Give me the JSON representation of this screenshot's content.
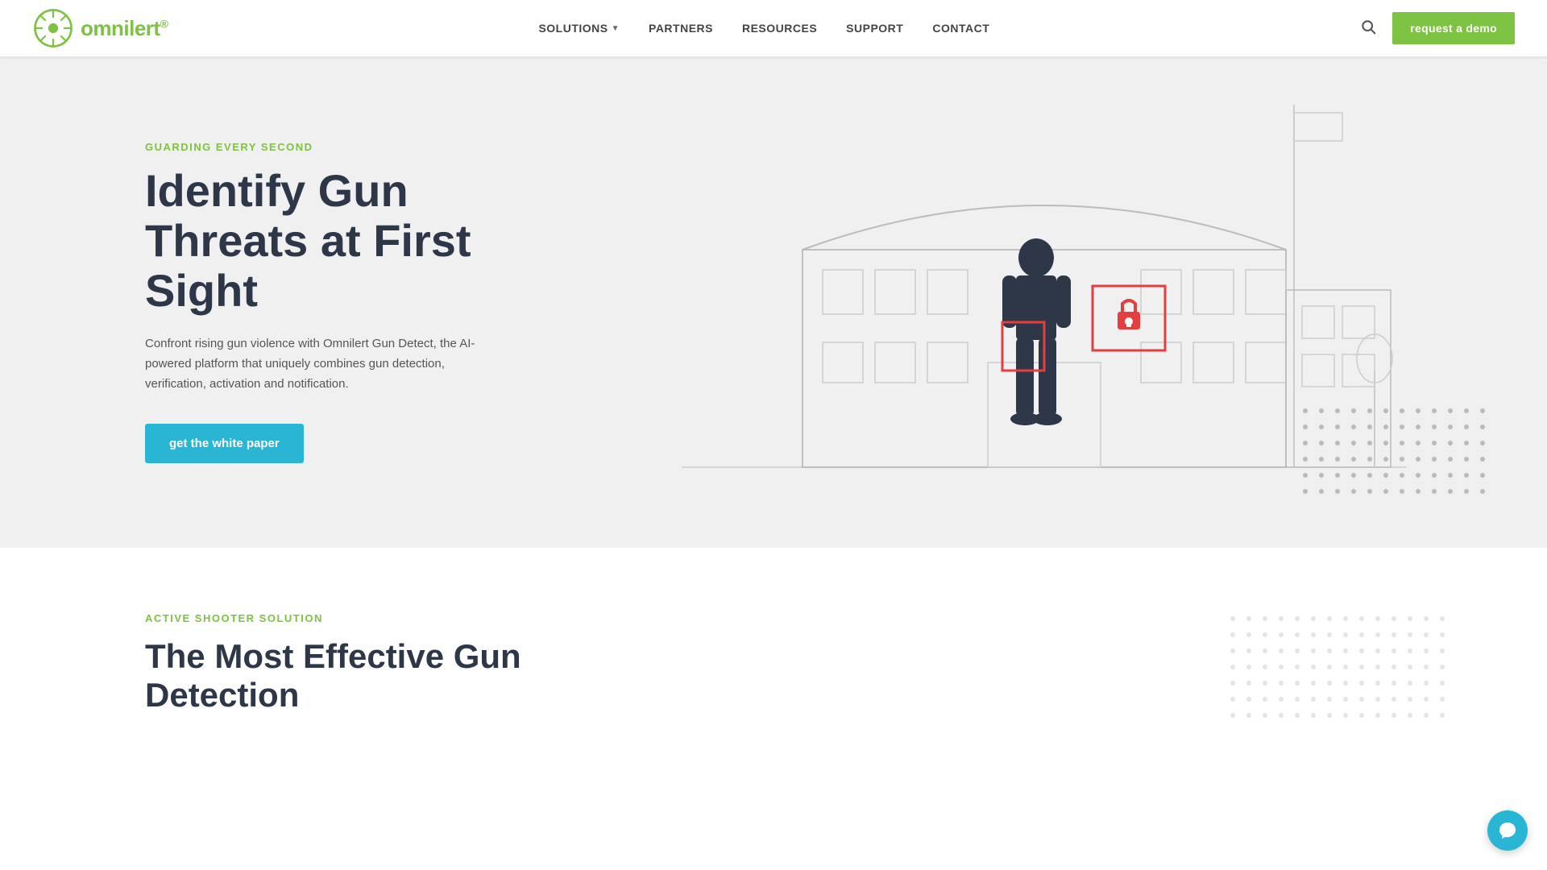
{
  "navbar": {
    "logo_text": "omnilert",
    "logo_trademark": "®",
    "nav_items": [
      {
        "label": "SOLUTIONS",
        "has_dropdown": true
      },
      {
        "label": "PARTNERS",
        "has_dropdown": false
      },
      {
        "label": "RESOURCES",
        "has_dropdown": false
      },
      {
        "label": "SUPPORT",
        "has_dropdown": false
      },
      {
        "label": "CONTACT",
        "has_dropdown": false
      }
    ],
    "request_demo_label": "request a demo",
    "search_aria": "search"
  },
  "hero": {
    "eyebrow": "GUARDING EVERY SECOND",
    "title_line1": "Identify Gun",
    "title_line2": "Threats at First",
    "title_line3": "Sight",
    "description": "Confront rising gun violence with Omnilert Gun Detect, the AI-powered platform that uniquely combines gun detection, verification, activation and notification.",
    "cta_label": "get the white paper"
  },
  "second_section": {
    "eyebrow": "ACTIVE SHOOTER SOLUTION",
    "title_line1": "The Most Effective Gun Detection"
  },
  "chat": {
    "aria": "chat support"
  },
  "colors": {
    "green": "#7dc241",
    "cyan": "#29b6d5",
    "red": "#e53e3e",
    "dark": "#2d3748",
    "gray_text": "#555",
    "bg_hero": "#f0f0f0"
  }
}
